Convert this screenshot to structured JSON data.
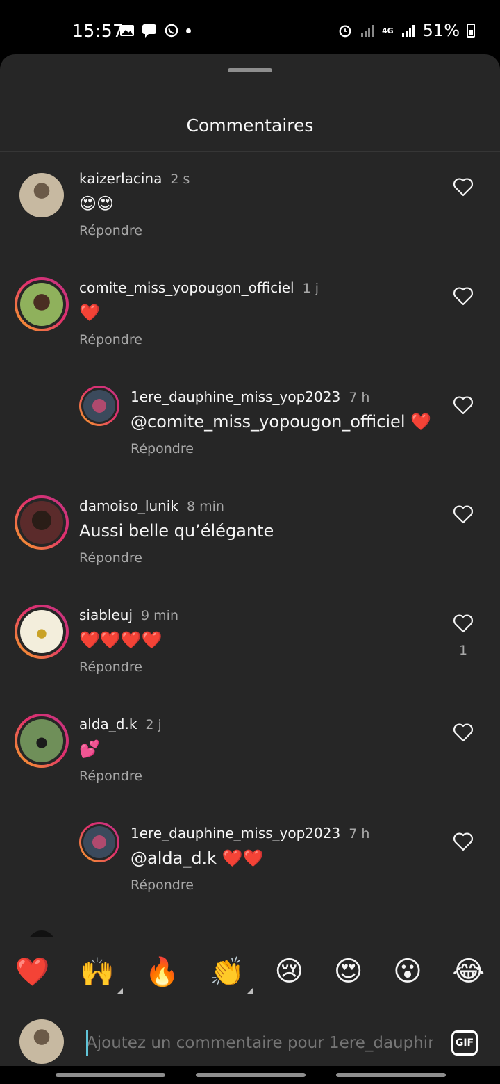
{
  "status_bar": {
    "time": "15:57",
    "network": "4G",
    "battery": "51%"
  },
  "sheet": {
    "title": "Commentaires"
  },
  "comments": [
    {
      "user": "kaizerlacina",
      "time": "2 s",
      "text": "😍😍",
      "reply_label": "Répondre",
      "likes": ""
    },
    {
      "user": "comite_miss_yopougon_officiel",
      "time": "1 j",
      "text": "❤️",
      "reply_label": "Répondre",
      "likes": ""
    },
    {
      "user": "1ere_dauphine_miss_yop2023",
      "time": "7 h",
      "text": "@comite_miss_yopougon_officiel ❤️",
      "reply_label": "Répondre",
      "likes": ""
    },
    {
      "user": "damoiso_lunik",
      "time": "8 min",
      "text": "Aussi belle qu’élégante",
      "reply_label": "Répondre",
      "likes": ""
    },
    {
      "user": "siableuj",
      "time": "9 min",
      "text": "❤️❤️❤️❤️",
      "reply_label": "Répondre",
      "likes": "1"
    },
    {
      "user": "alda_d.k",
      "time": "2 j",
      "text": "💕",
      "reply_label": "Répondre",
      "likes": ""
    },
    {
      "user": "1ere_dauphine_miss_yop2023",
      "time": "7 h",
      "text": "@alda_d.k ❤️❤️",
      "reply_label": "Répondre",
      "likes": ""
    }
  ],
  "quick_reactions": [
    "❤️",
    "🙌",
    "🔥",
    "👏",
    "😢",
    "😍",
    "😮",
    "😂"
  ],
  "composer": {
    "placeholder": "Ajoutez un commentaire pour 1ere_dauphin",
    "gif_label": "GIF"
  },
  "colors": {
    "background": "#262626",
    "accent_caret": "#60c4d8",
    "muted_text": "#a8a8a8"
  },
  "icons": [
    "image-icon",
    "chat-icon",
    "whatsapp-icon",
    "alarm-icon",
    "signal-icon",
    "battery-icon",
    "heart-outline-icon",
    "gif-icon"
  ]
}
